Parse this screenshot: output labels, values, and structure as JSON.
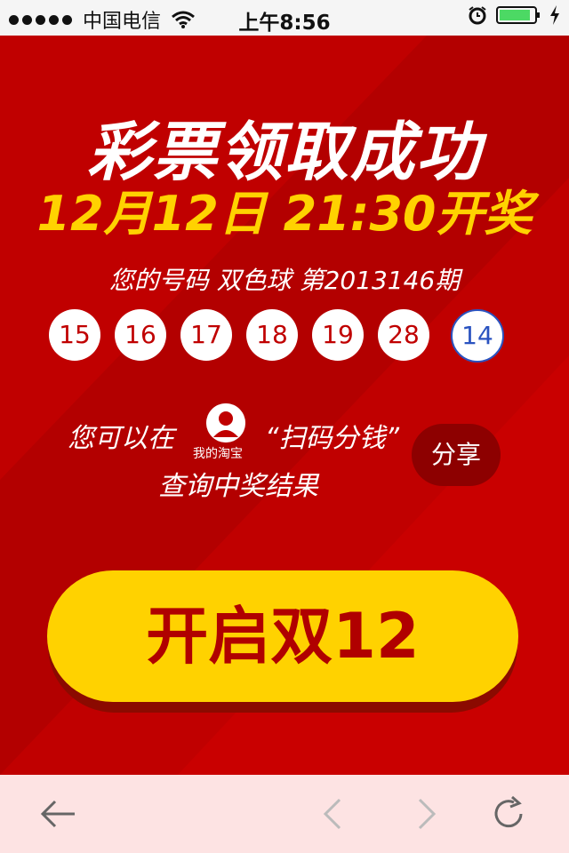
{
  "status_bar": {
    "carrier": "中国电信",
    "time": "上午8:56"
  },
  "main": {
    "title": "彩票领取成功",
    "draw_time": "12月12日 21:30开奖",
    "ticket_label": "您的号码 双色球 第2013146期",
    "numbers": [
      "15",
      "16",
      "17",
      "18",
      "19",
      "28",
      "14"
    ],
    "info_line1_prefix": "您可以在",
    "avatar_label": "我的淘宝",
    "info_line1_suffix": "“扫码分钱”",
    "info_line2": "查询中奖结果",
    "share_label": "分享",
    "cta_label": "开启双12"
  },
  "colors": {
    "background": "#c00000",
    "accent": "#ffd200",
    "blue_ball": "#2a53c0"
  },
  "toolbar": {
    "icons": [
      "back-arrow-icon",
      "chevron-left-icon",
      "chevron-right-icon",
      "refresh-icon"
    ]
  }
}
